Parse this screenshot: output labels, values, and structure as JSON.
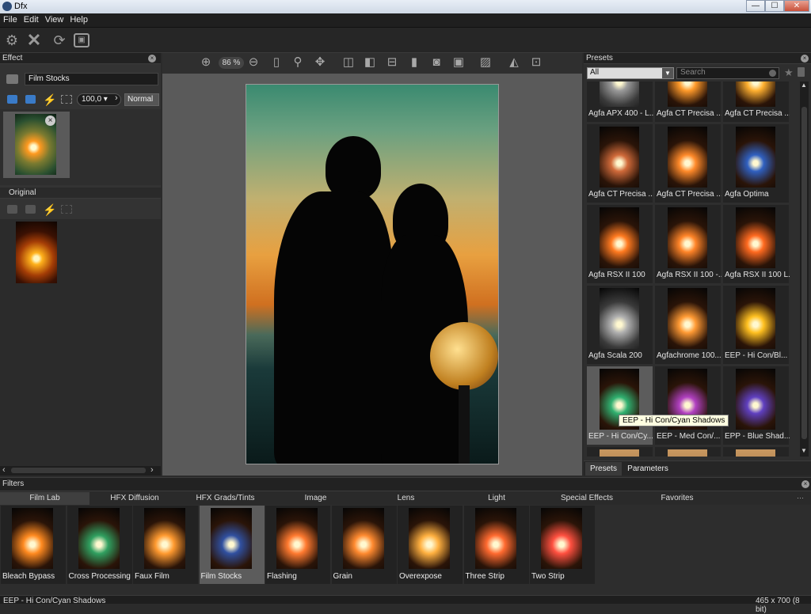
{
  "window": {
    "title": "Dfx",
    "btn_min": "—",
    "btn_max": "☐",
    "btn_close": "✕"
  },
  "menu": [
    "File",
    "Edit",
    "View",
    "Help"
  ],
  "left": {
    "effect_header": "Effect",
    "effect_value": "Film Stocks",
    "opacity": "100,0",
    "blend_mode": "Normal",
    "original_header": "Original"
  },
  "center": {
    "zoom": "86 %"
  },
  "right": {
    "presets_header": "Presets",
    "filter_value": "All",
    "search_placeholder": "Search",
    "tab_presets": "Presets",
    "tab_parameters": "Parameters",
    "tooltip": "EEP - Hi Con/Cyan Shadows",
    "presets": [
      {
        "label": "Agfa APX 400 - L...",
        "tint": "#9a9a9a",
        "dark": true
      },
      {
        "label": "Agfa CT Precisa ...",
        "tint": "#ff9a2a"
      },
      {
        "label": "Agfa CT Precisa ...",
        "tint": "#ffb030"
      },
      {
        "label": "Agfa CT Precisa ...",
        "tint": "#d06a3a"
      },
      {
        "label": "Agfa CT Precisa ...",
        "tint": "#ff8a2a"
      },
      {
        "label": "Agfa Optima",
        "tint": "#3060c0"
      },
      {
        "label": "Agfa RSX II 100",
        "tint": "#ff7a20"
      },
      {
        "label": "Agfa RSX II 100 -...",
        "tint": "#ff8428"
      },
      {
        "label": "Agfa RSX II 100 L...",
        "tint": "#ff6a20"
      },
      {
        "label": "Agfa Scala 200",
        "tint": "#b0b0b0",
        "dark": true
      },
      {
        "label": "Agfachrome 100...",
        "tint": "#ff9a34"
      },
      {
        "label": "EEP - Hi Con/Bl...",
        "tint": "#ffc020"
      },
      {
        "label": "EEP - Hi Con/Cy...",
        "tint": "#30b070",
        "selected": true
      },
      {
        "label": "EEP - Med Con/...",
        "tint": "#b040c0"
      },
      {
        "label": "EPP - Blue Shad...",
        "tint": "#6040c0"
      }
    ]
  },
  "filters": {
    "header": "Filters",
    "tabs": [
      "Film Lab",
      "HFX Diffusion",
      "HFX Grads/Tints",
      "Image",
      "Lens",
      "Light",
      "Special Effects",
      "Favorites"
    ],
    "items": [
      {
        "label": "Bleach Bypass",
        "tint": "#ff8a20"
      },
      {
        "label": "Cross Processing",
        "tint": "#30a060"
      },
      {
        "label": "Faux Film",
        "tint": "#ff9a30"
      },
      {
        "label": "Film Stocks",
        "tint": "#3050a0",
        "selected": true
      },
      {
        "label": "Flashing",
        "tint": "#ff7a30"
      },
      {
        "label": "Grain",
        "tint": "#ff8a30"
      },
      {
        "label": "Overexpose",
        "tint": "#ffb040"
      },
      {
        "label": "Three Strip",
        "tint": "#ff6a30"
      },
      {
        "label": "Two Strip",
        "tint": "#ff5040"
      }
    ]
  },
  "status": {
    "left": "EEP - Hi Con/Cyan Shadows",
    "right": "465 x 700 (8 bit)"
  }
}
